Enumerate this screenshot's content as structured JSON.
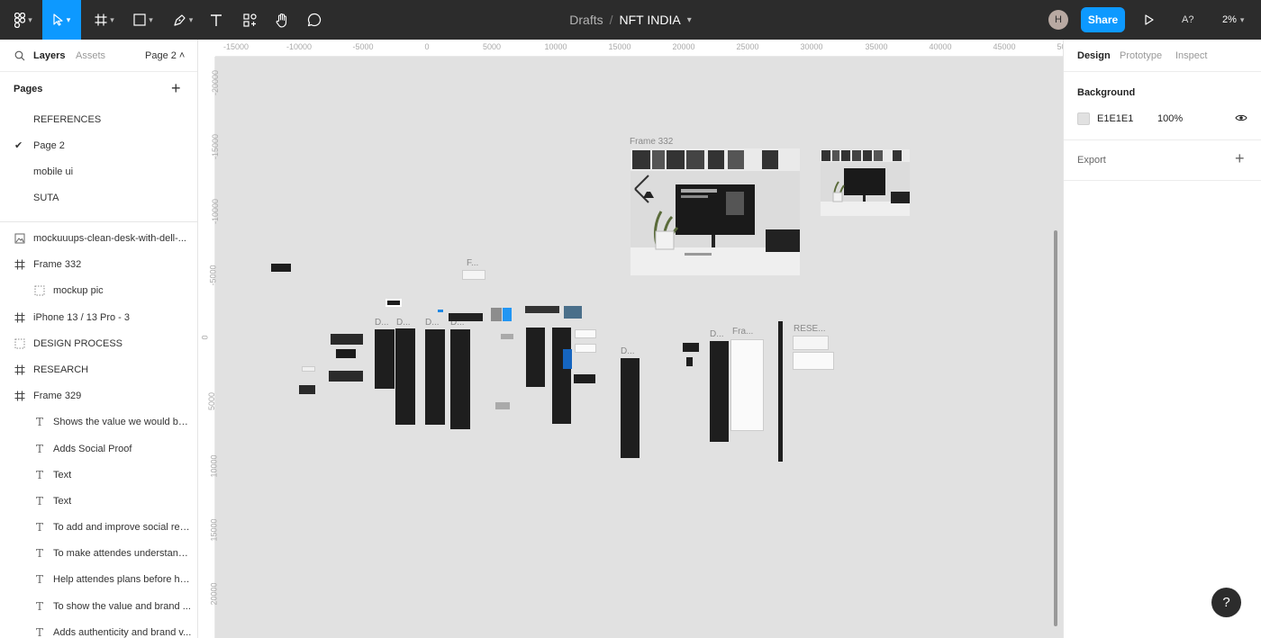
{
  "toolbar": {
    "breadcrumb_parent": "Drafts",
    "breadcrumb_sep": "/",
    "file_name": "NFT INDIA",
    "avatar_initial": "H",
    "share_label": "Share",
    "ai_label": "A?",
    "zoom": "2%"
  },
  "left_panel": {
    "tab_layers": "Layers",
    "tab_assets": "Assets",
    "page_selector": "Page 2 ˄",
    "pages_label": "Pages",
    "pages": [
      {
        "label": "REFERENCES",
        "selected": false
      },
      {
        "label": "Page 2",
        "selected": true
      },
      {
        "label": "mobile ui",
        "selected": false
      },
      {
        "label": "SUTA",
        "selected": false
      }
    ],
    "layers": [
      {
        "label": "mockuuups-clean-desk-with-dell-...",
        "icon": "image-icon",
        "level": 0,
        "bold": false
      },
      {
        "label": "Frame 332",
        "icon": "frame-icon",
        "level": 0,
        "bold": false
      },
      {
        "label": "mockup pic",
        "icon": "group-icon",
        "level": 1,
        "bold": false
      },
      {
        "label": "iPhone 13 / 13 Pro - 3",
        "icon": "frame-icon",
        "level": 0,
        "bold": false
      },
      {
        "label": "DESIGN PROCESS",
        "icon": "group-icon",
        "level": 0,
        "bold": false
      },
      {
        "label": "RESEARCH",
        "icon": "frame-icon",
        "level": 0,
        "bold": false
      },
      {
        "label": "Frame 329",
        "icon": "frame-icon",
        "level": 0,
        "bold": false
      },
      {
        "label": "Shows the value we would be...",
        "icon": "text-icon",
        "level": 1,
        "bold": false
      },
      {
        "label": "Adds Social Proof",
        "icon": "text-icon",
        "level": 1,
        "bold": false
      },
      {
        "label": "Text",
        "icon": "text-icon",
        "level": 1,
        "bold": false
      },
      {
        "label": "Text",
        "icon": "text-icon",
        "level": 1,
        "bold": false
      },
      {
        "label": "To add and improve social res...",
        "icon": "text-icon",
        "level": 1,
        "bold": false
      },
      {
        "label": "To make attendes understand...",
        "icon": "text-icon",
        "level": 1,
        "bold": false
      },
      {
        "label": "Help attendes plans before ha...",
        "icon": "text-icon",
        "level": 1,
        "bold": false
      },
      {
        "label": "To show the value and brand ...",
        "icon": "text-icon",
        "level": 1,
        "bold": false
      },
      {
        "label": "Adds authenticity and brand v...",
        "icon": "text-icon",
        "level": 1,
        "bold": false
      }
    ]
  },
  "canvas": {
    "background": "#E1E1E1",
    "ruler_top": [
      "-15000",
      "-10000",
      "-5000",
      "0",
      "5000",
      "10000",
      "15000",
      "20000",
      "25000",
      "30000",
      "35000",
      "40000",
      "45000",
      "50000"
    ],
    "ruler_left": [
      "-20000",
      "-15000",
      "-10000",
      "-5000",
      "0",
      "5000",
      "10000",
      "15000",
      "20000"
    ],
    "frame_labels": {
      "frame332": "Frame 332",
      "f_dots": "F...",
      "d1": "D...",
      "d2": "D...",
      "d3": "D...",
      "d4": "D...",
      "d5": "D...",
      "d6": "D...",
      "fra": "Fra...",
      "rese": "RESE..."
    }
  },
  "right_panel": {
    "tab_design": "Design",
    "tab_prototype": "Prototype",
    "tab_inspect": "Inspect",
    "background_label": "Background",
    "background_hex": "E1E1E1",
    "background_opacity": "100%",
    "export_label": "Export",
    "help": "?"
  }
}
